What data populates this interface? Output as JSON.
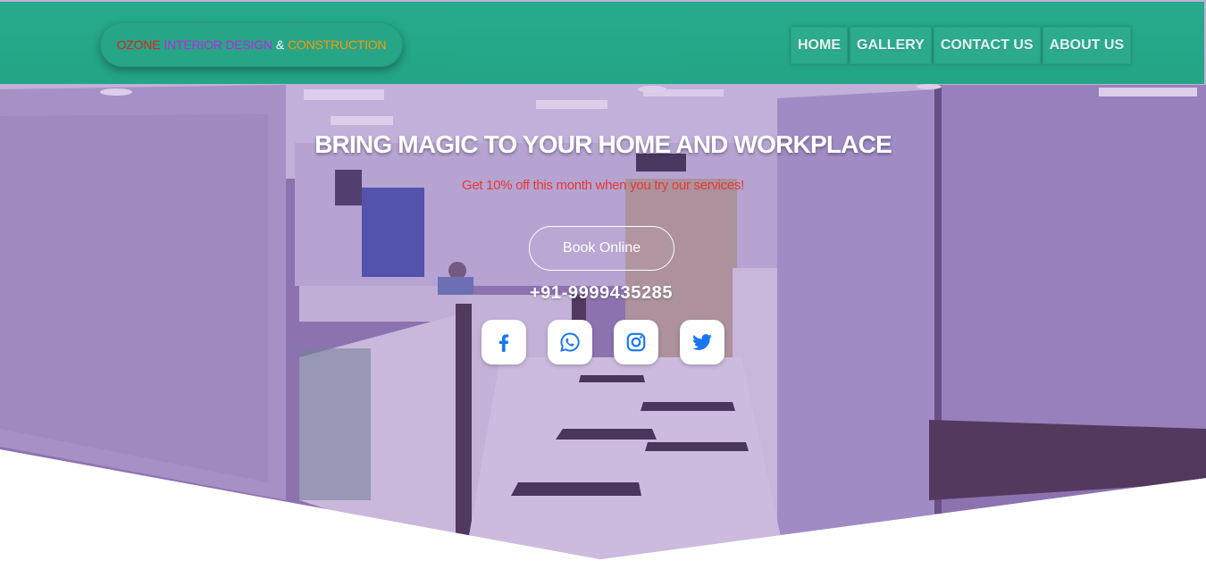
{
  "brand": {
    "word1": "OZONE",
    "word2": "INTERIOR DESIGN",
    "word3": "&",
    "word4": "CONSTRUCTION"
  },
  "nav": {
    "items": [
      {
        "label": "HOME"
      },
      {
        "label": "GALLERY"
      },
      {
        "label": "CONTACT US"
      },
      {
        "label": "ABOUT US"
      }
    ]
  },
  "hero": {
    "title": "BRING MAGIC TO YOUR HOME AND WORKPLACE",
    "offer": "Get 10% off this month when you try our services!",
    "book_label": "Book Online",
    "phone": "+91-9999435285"
  },
  "socials": [
    {
      "icon": "facebook-icon"
    },
    {
      "icon": "whatsapp-icon"
    },
    {
      "icon": "instagram-icon"
    },
    {
      "icon": "twitter-icon"
    }
  ],
  "colors": {
    "header_green": "#22ab8a",
    "brand_red": "#e31c1c",
    "brand_purple": "#c41ee8",
    "brand_orange": "#ff9800",
    "offer_red": "#e53935",
    "social_blue": "#1877f2",
    "hero_tint": "#8c5cbe"
  }
}
